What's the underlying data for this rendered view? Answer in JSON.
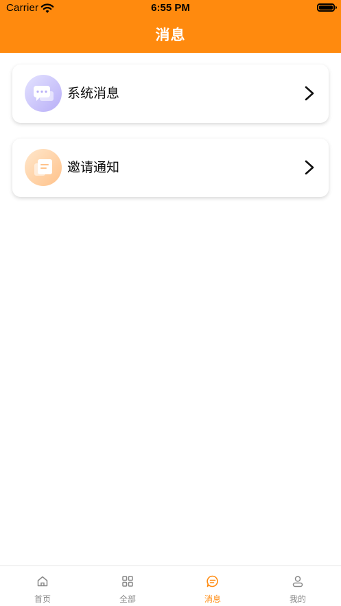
{
  "status_bar": {
    "carrier": "Carrier",
    "time": "6:55 PM"
  },
  "header": {
    "title": "消息",
    "background_color": "#FF8A0E"
  },
  "messages": [
    {
      "label": "系统消息",
      "icon": "chat-bubble-icon"
    },
    {
      "label": "邀请通知",
      "icon": "document-note-icon"
    }
  ],
  "tabbar": {
    "active_color": "#FF8A0E",
    "inactive_color": "#888888",
    "tabs": [
      {
        "label": "首页",
        "icon": "home-icon",
        "active": false
      },
      {
        "label": "全部",
        "icon": "grid-icon",
        "active": false
      },
      {
        "label": "消息",
        "icon": "message-icon",
        "active": true
      },
      {
        "label": "我的",
        "icon": "user-icon",
        "active": false
      }
    ]
  }
}
